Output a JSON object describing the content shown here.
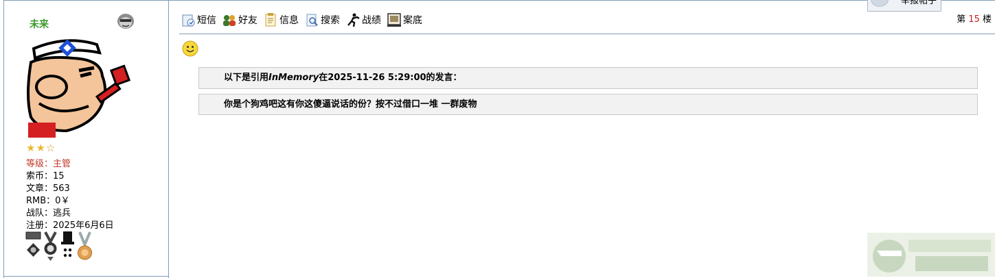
{
  "user": {
    "name": "未来",
    "stars_filled": 2,
    "stars_total": 3,
    "level": "等级：主管",
    "coins": "索币：15",
    "posts": "文章：563",
    "rmb": "RMB：0￥",
    "team": "战队：逃兵",
    "registered": "注册：2025年6月6日"
  },
  "toolbar": {
    "items": [
      {
        "label": "短信",
        "icon": "message-icon"
      },
      {
        "label": "好友",
        "icon": "friends-icon"
      },
      {
        "label": "信息",
        "icon": "info-icon"
      },
      {
        "label": "搜索",
        "icon": "search-icon"
      },
      {
        "label": "战绩",
        "icon": "record-icon"
      },
      {
        "label": "案底",
        "icon": "file-icon"
      }
    ],
    "report_label": "举报帖子"
  },
  "floor": {
    "prefix": "第",
    "number": "15",
    "suffix": "楼"
  },
  "quote": {
    "head_prefix": "以下是引用",
    "head_user": "InMemory",
    "head_suffix": "在2025-11-26 5:29:00的发言：",
    "text": "你是个狗鸡吧这有你这傻逼说话的份？按不过借口一堆 一群废物"
  },
  "colors": {
    "border": "#7f9db9",
    "username": "#3a9a2a",
    "level": "#c0392b",
    "floor_number": "#d02020",
    "quote_bg": "#f2f2f2"
  }
}
